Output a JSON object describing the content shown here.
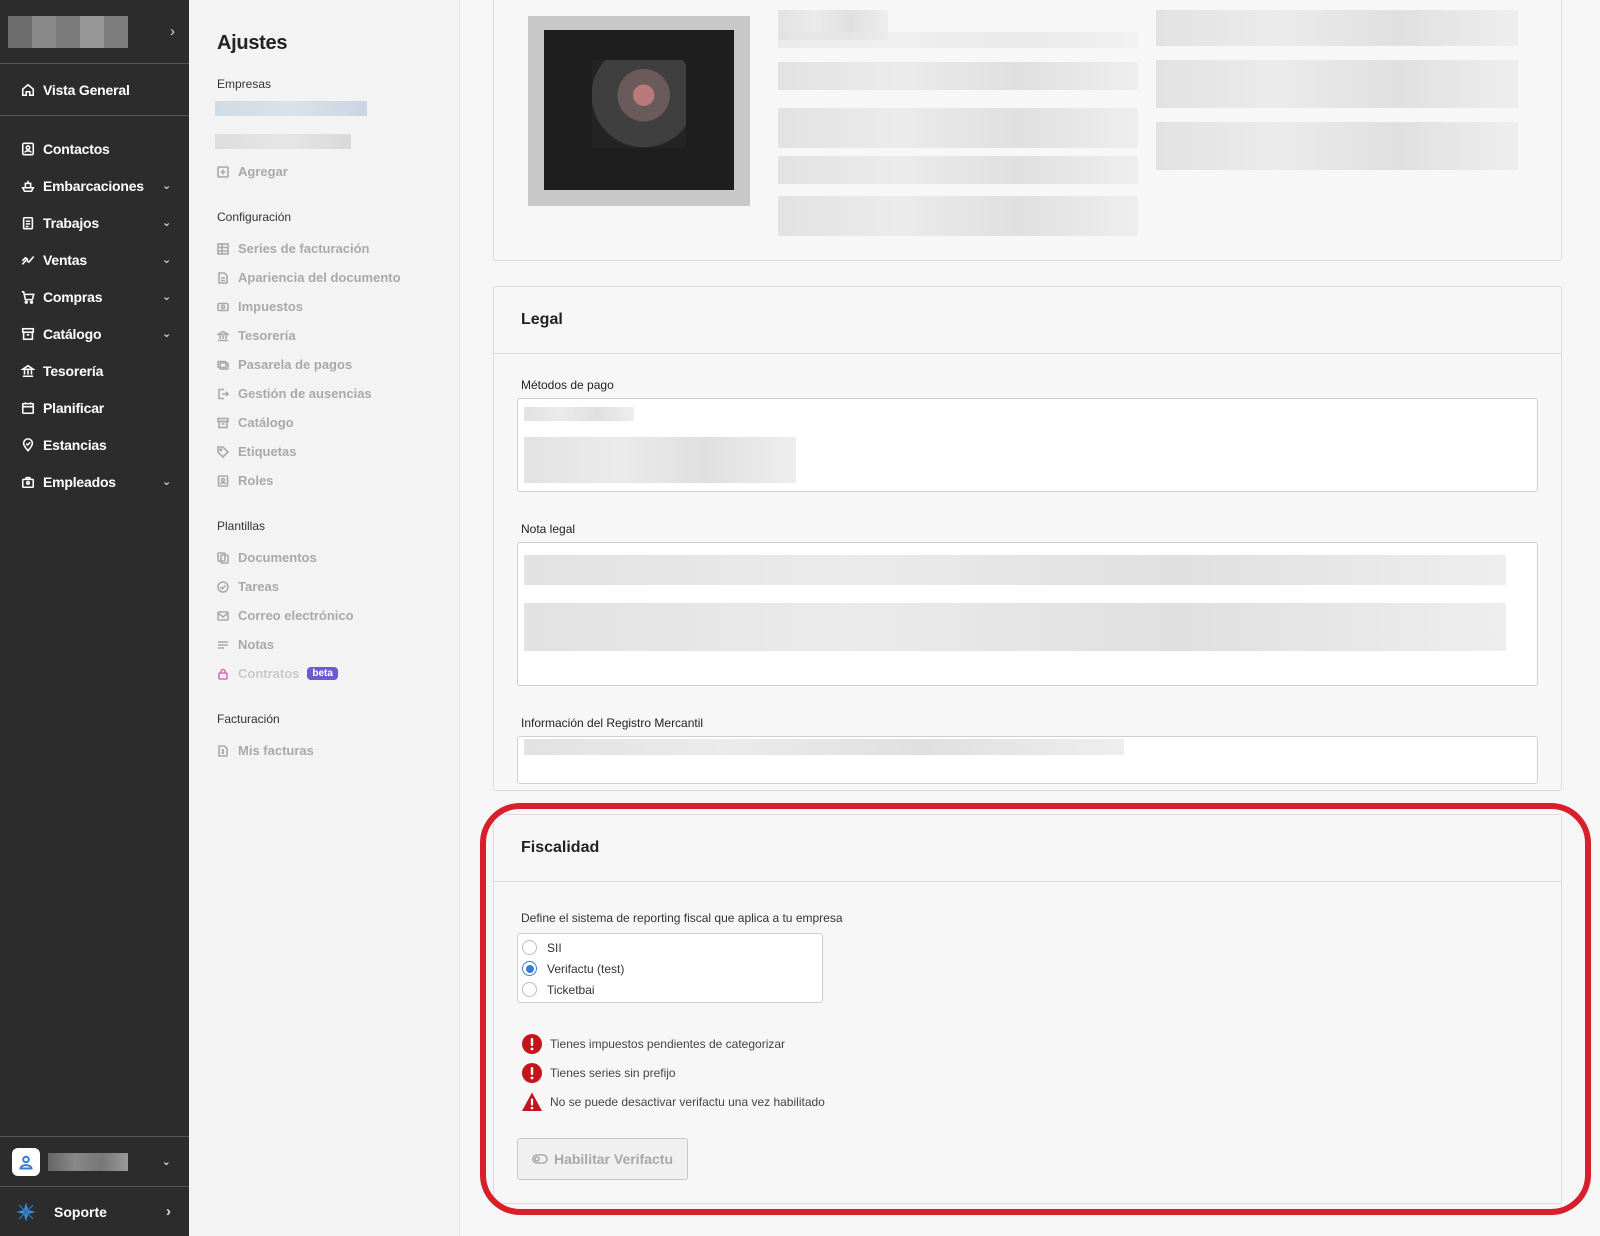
{
  "sidebar": {
    "overview": "Vista General",
    "items": [
      {
        "label": "Contactos",
        "icon": "contacts-icon",
        "expandable": false
      },
      {
        "label": "Embarcaciones",
        "icon": "boat-icon",
        "expandable": true
      },
      {
        "label": "Trabajos",
        "icon": "clipboard-icon",
        "expandable": true
      },
      {
        "label": "Ventas",
        "icon": "trend-icon",
        "expandable": true
      },
      {
        "label": "Compras",
        "icon": "cart-icon",
        "expandable": true
      },
      {
        "label": "Catálogo",
        "icon": "catalog-icon",
        "expandable": true
      },
      {
        "label": "Tesorería",
        "icon": "bank-icon",
        "expandable": false
      },
      {
        "label": "Planificar",
        "icon": "calendar-icon",
        "expandable": false
      },
      {
        "label": "Estancias",
        "icon": "location-icon",
        "expandable": false
      },
      {
        "label": "Empleados",
        "icon": "employees-icon",
        "expandable": true
      }
    ],
    "support": "Soporte"
  },
  "subnav": {
    "title": "Ajustes",
    "companies_section": "Empresas",
    "add_label": "Agregar",
    "config_section": "Configuración",
    "config_items": [
      "Series de facturación",
      "Apariencia del documento",
      "Impuestos",
      "Tesorería",
      "Pasarela de pagos",
      "Gestión de ausencias",
      "Catálogo",
      "Etiquetas",
      "Roles"
    ],
    "templates_section": "Plantillas",
    "template_items": [
      "Documentos",
      "Tareas",
      "Correo electrónico",
      "Notas",
      "Contratos"
    ],
    "beta_badge": "beta",
    "billing_section": "Facturación",
    "billing_items": [
      "Mis facturas"
    ]
  },
  "legal": {
    "title": "Legal",
    "payment_methods_label": "Métodos de pago",
    "legal_note_label": "Nota legal",
    "registry_label": "Información del Registro Mercantil"
  },
  "fiscal": {
    "title": "Fiscalidad",
    "description": "Define el sistema de reporting fiscal que aplica a tu empresa",
    "options": [
      "SII",
      "Verifactu (test)",
      "Ticketbai"
    ],
    "selected_option": "Verifactu (test)",
    "warnings": [
      {
        "text": "Tienes impuestos pendientes de categorizar",
        "type": "error"
      },
      {
        "text": "Tienes series sin prefijo",
        "type": "error"
      },
      {
        "text": "No se puede desactivar verifactu una vez habilitado",
        "type": "warning"
      }
    ],
    "button_label": "Habilitar Verifactu"
  },
  "colors": {
    "sidebar_bg": "#2c2c2c",
    "accent": "#3a7bd5",
    "error": "#c4141c",
    "highlight": "#d8202c",
    "beta": "#6b5bd2"
  }
}
